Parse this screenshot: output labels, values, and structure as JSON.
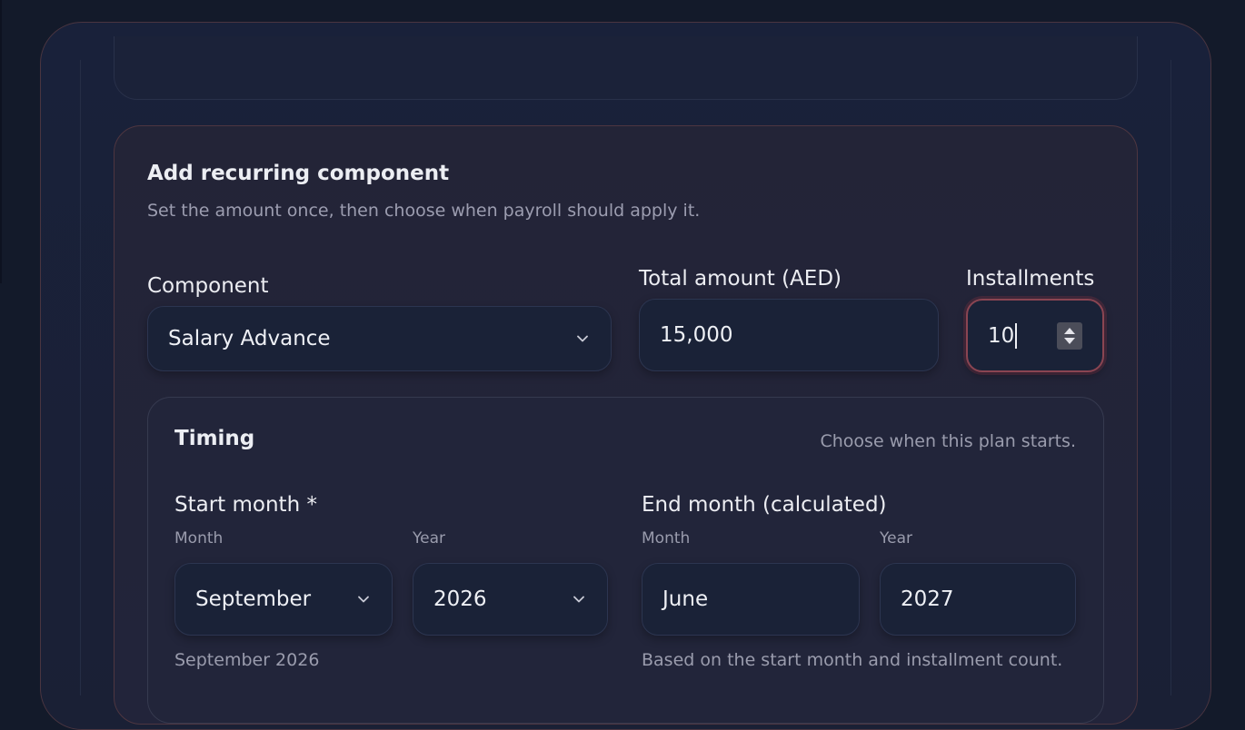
{
  "form": {
    "title": "Add recurring component",
    "subtitle": "Set the amount once, then choose when payroll should apply it.",
    "component": {
      "label": "Component",
      "value": "Salary Advance"
    },
    "total_amount": {
      "label": "Total amount (AED)",
      "value": "15,000"
    },
    "installments": {
      "label": "Installments",
      "value": "10"
    },
    "timing": {
      "title": "Timing",
      "hint": "Choose when this plan starts.",
      "start": {
        "label": "Start month *",
        "month_label": "Month",
        "month_value": "September",
        "year_label": "Year",
        "year_value": "2026",
        "summary": "September 2026"
      },
      "end": {
        "label": "End month (calculated)",
        "month_label": "Month",
        "month_value": "June",
        "year_label": "Year",
        "year_value": "2027",
        "note": "Based on the start month and installment count."
      }
    }
  },
  "colors": {
    "background": "#131a2a",
    "accent_border": "#8a4552",
    "card_border": "#4e3640"
  },
  "icons": {
    "dropdown": "chevron-down-icon",
    "stepper": "spinner-arrows-icon"
  }
}
